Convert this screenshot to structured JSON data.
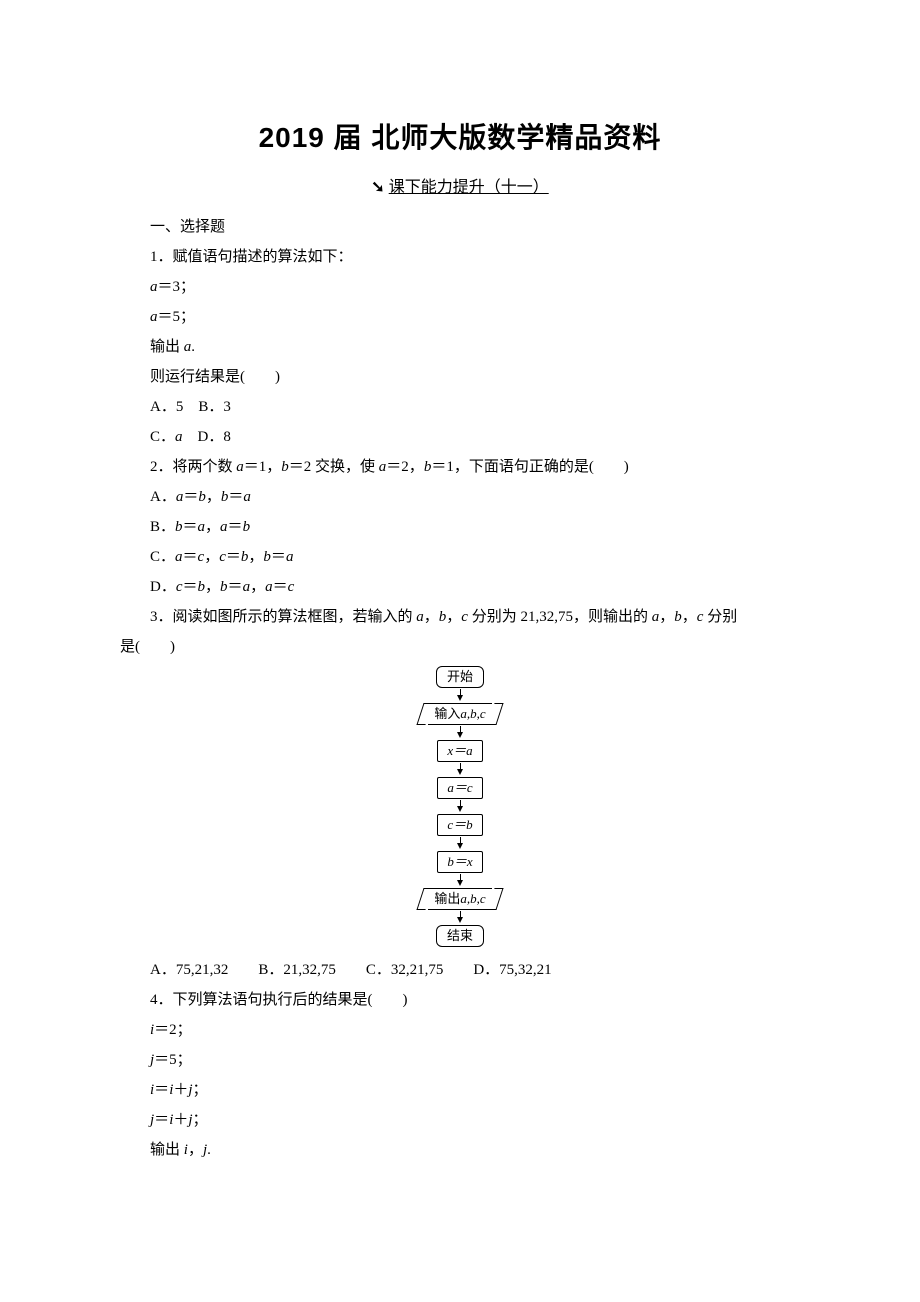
{
  "title": "2019 届 北师大版数学精品资料",
  "subtitle_arrow": "➘",
  "subtitle": "课下能力提升（十一）",
  "section1_heading": "一、选择题",
  "q1": {
    "stem": "1．赋值语句描述的算法如下：",
    "l1_pre": "a",
    "l1_post": "＝3；",
    "l2_pre": "a",
    "l2_post": "＝5；",
    "l3_pre": "输出 ",
    "l3_var": "a",
    "l3_post": ".",
    "l4": "则运行结果是(　　)",
    "optA": "A．5　B．3",
    "optC_pre": "C．",
    "optC_var": "a",
    "optC_post": "　D．8"
  },
  "q2": {
    "stem_pre": "2．将两个数 ",
    "stem_a": "a",
    "stem_mid1": "＝1，",
    "stem_b": "b",
    "stem_mid2": "＝2 交换，使 ",
    "stem_a2": "a",
    "stem_mid3": "＝2，",
    "stem_b2": "b",
    "stem_mid4": "＝1，下面语句正确的是(　　)",
    "A_pre": "A．",
    "A_1a": "a",
    "A_1m": "＝",
    "A_1b": "b",
    "A_comma": "，",
    "A_2a": "b",
    "A_2m": "＝",
    "A_2b": "a",
    "B_pre": "B．",
    "B_1a": "b",
    "B_1m": "＝",
    "B_1b": "a",
    "B_comma": "，",
    "B_2a": "a",
    "B_2m": "＝",
    "B_2b": "b",
    "C_pre": "C．",
    "C_1a": "a",
    "C_1m": "＝",
    "C_1b": "c",
    "C_c1": "，",
    "C_2a": "c",
    "C_2m": "＝",
    "C_2b": "b",
    "C_c2": "，",
    "C_3a": "b",
    "C_3m": "＝",
    "C_3b": "a",
    "D_pre": "D．",
    "D_1a": "c",
    "D_1m": "＝",
    "D_1b": "b",
    "D_c1": "，",
    "D_2a": "b",
    "D_2m": "＝",
    "D_2b": "a",
    "D_c2": "，",
    "D_3a": "a",
    "D_3m": "＝",
    "D_3b": "c"
  },
  "q3": {
    "stem_pre": "3．阅读如图所示的算法框图，若输入的 ",
    "a": "a",
    "c1": "，",
    "b": "b",
    "c2": "，",
    "c": "c",
    "mid": " 分别为 21,32,75，则输出的 ",
    "a2": "a",
    "c3": "，",
    "b2": "b",
    "c4": "，",
    "c2v": "c",
    "tail": " 分别",
    "line2": "是(　　)",
    "flow": {
      "start": "开始",
      "in_pre": "输入",
      "in_vars": "a,b,c",
      "s1": "x＝a",
      "s2": "a＝c",
      "s3": "c＝b",
      "s4": "b＝x",
      "out_pre": "输出",
      "out_vars": "a,b,c",
      "end": "结束"
    },
    "opts": "A．75,21,32　　B．21,32,75　　C．32,21,75　　D．75,32,21"
  },
  "q4": {
    "stem": "4．下列算法语句执行后的结果是(　　)",
    "l1_v": "i",
    "l1_p": "＝2；",
    "l2_v": "j",
    "l2_p": "＝5；",
    "l3_a": "i",
    "l3_m": "＝",
    "l3_b": "i",
    "l3_plus": "＋",
    "l3_c": "j",
    "l3_end": "；",
    "l4_a": "j",
    "l4_m": "＝",
    "l4_b": "i",
    "l4_plus": "＋",
    "l4_c": "j",
    "l4_end": "；",
    "l5_pre": "输出 ",
    "l5_i": "i",
    "l5_comma": "，",
    "l5_j": "j",
    "l5_post": "."
  }
}
